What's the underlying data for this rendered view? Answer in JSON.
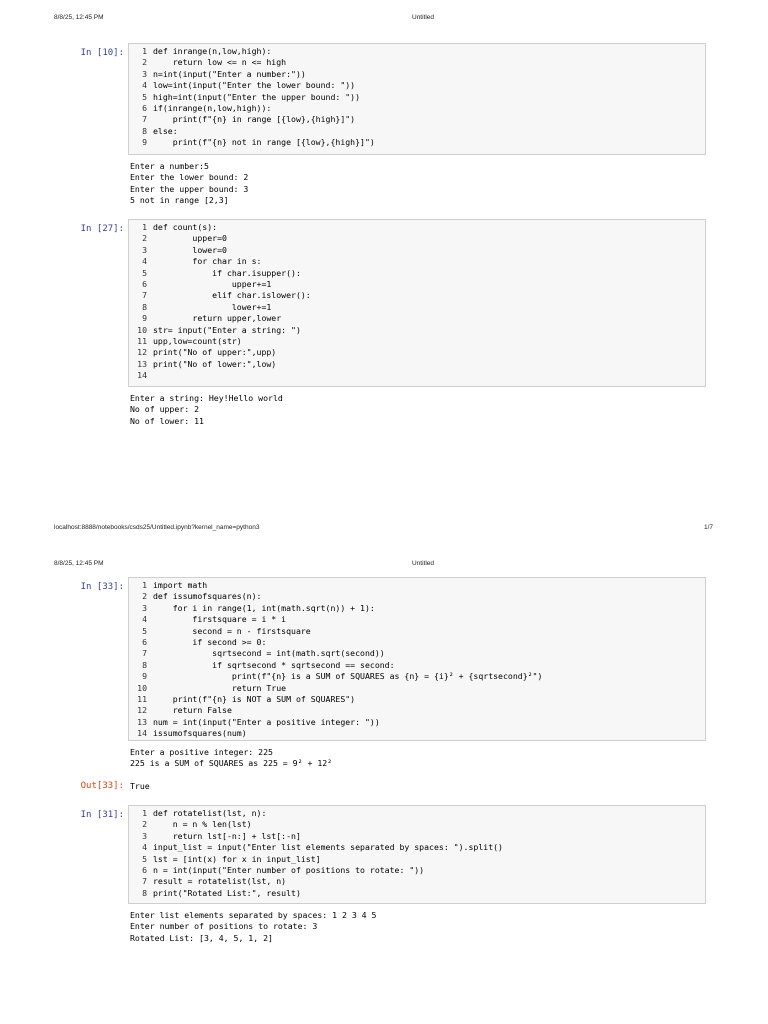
{
  "page1": {
    "header_date": "8/8/25, 12:45 PM",
    "header_title": "Untitled",
    "footer_url": "localhost:8888/notebooks/csds25/Untitled.ipynb?kernel_name=python3",
    "footer_page": "1/7"
  },
  "page2": {
    "header_date": "8/8/25, 12:45 PM",
    "header_title": "Untitled"
  },
  "cells": [
    {
      "prompt": "In [10]:",
      "code": [
        "def inrange(n,low,high):",
        "    return low <= n <= high",
        "n=int(input(\"Enter a number:\"))",
        "low=int(input(\"Enter the lower bound: \"))",
        "high=int(input(\"Enter the upper bound: \"))",
        "if(inrange(n,low,high)):",
        "    print(f\"{n} in range [{low},{high}]\")",
        "else:",
        "    print(f\"{n} not in range [{low},{high}]\")"
      ],
      "output": [
        "Enter a number:5",
        "Enter the lower bound: 2",
        "Enter the upper bound: 3",
        "5 not in range [2,3]"
      ]
    },
    {
      "prompt": "In [27]:",
      "code": [
        "def count(s):",
        "        upper=0",
        "        lower=0",
        "        for char in s:",
        "            if char.isupper():",
        "                upper+=1",
        "            elif char.islower():",
        "                lower+=1",
        "        return upper,lower",
        "str= input(\"Enter a string: \")",
        "upp,low=count(str)",
        "print(\"No of upper:\",upp)",
        "print(\"No of lower:\",low)",
        ""
      ],
      "output": [
        "Enter a string: Hey!Hello world",
        "No of upper: 2",
        "No of lower: 11"
      ]
    },
    {
      "prompt": "In [33]:",
      "code": [
        "import math",
        "def issumofsquares(n):",
        "    for i in range(1, int(math.sqrt(n)) + 1):",
        "        firstsquare = i * i",
        "        second = n - firstsquare",
        "        if second >= 0:",
        "            sqrtsecond = int(math.sqrt(second))",
        "            if sqrtsecond * sqrtsecond == second:",
        "                print(f\"{n} is a SUM of SQUARES as {n} = {i}² + {sqrtsecond}²\")",
        "                return True",
        "    print(f\"{n} is NOT a SUM of SQUARES\")",
        "    return False",
        "num = int(input(\"Enter a positive integer: \"))",
        "issumofsquares(num)"
      ],
      "output": [
        "Enter a positive integer: 225",
        "225 is a SUM of SQUARES as 225 = 9² + 12²"
      ],
      "out_prompt": "Out[33]:",
      "out_value": "True"
    },
    {
      "prompt": "In [31]:",
      "code": [
        "def rotatelist(lst, n):",
        "    n = n % len(lst)",
        "    return lst[-n:] + lst[:-n]",
        "input_list = input(\"Enter list elements separated by spaces: \").split()",
        "lst = [int(x) for x in input_list]",
        "n = int(input(\"Enter number of positions to rotate: \"))",
        "result = rotatelist(lst, n)",
        "print(\"Rotated List:\", result)"
      ],
      "output": [
        "Enter list elements separated by spaces: 1 2 3 4 5",
        "Enter number of positions to rotate: 3",
        "Rotated List: [3, 4, 5, 1, 2]"
      ]
    }
  ]
}
